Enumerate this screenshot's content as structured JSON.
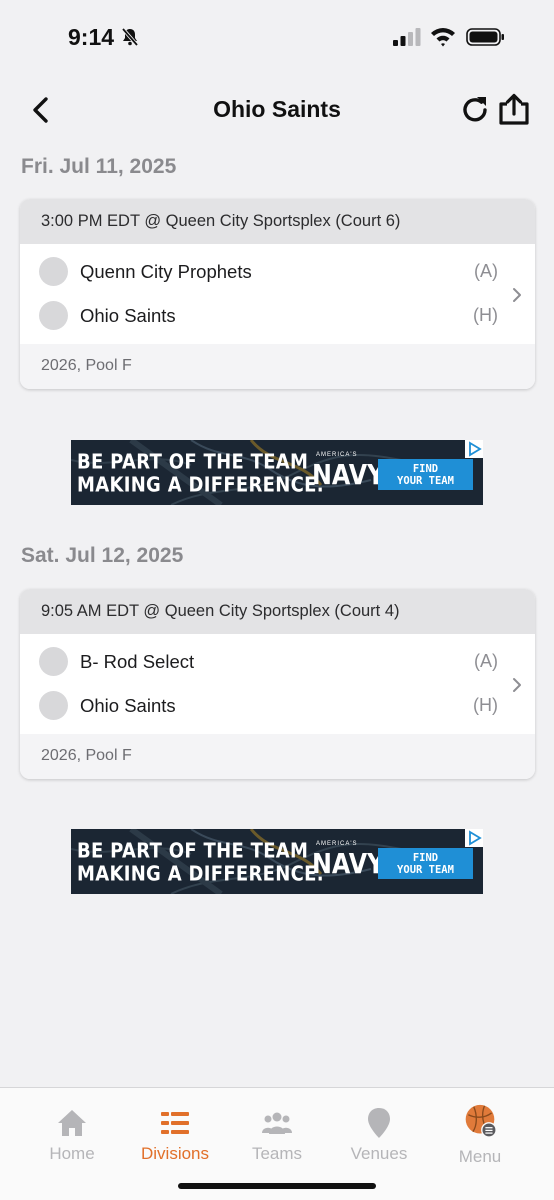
{
  "status_bar": {
    "time": "9:14"
  },
  "header": {
    "title": "Ohio Saints"
  },
  "games": [
    {
      "date": "Fri. Jul 11, 2025",
      "time_location": "3:00 PM EDT @ Queen City Sportsplex (Court 6)",
      "teams": [
        {
          "name": "Quenn City Prophets",
          "side": "(A)"
        },
        {
          "name": "Ohio Saints",
          "side": "(H)"
        }
      ],
      "division": "2026, Pool F"
    },
    {
      "date": "Sat. Jul 12, 2025",
      "time_location": "9:05 AM EDT @ Queen City Sportsplex (Court 4)",
      "teams": [
        {
          "name": "B- Rod Select",
          "side": "(A)"
        },
        {
          "name": "Ohio Saints",
          "side": "(H)"
        }
      ],
      "division": "2026, Pool F"
    }
  ],
  "ad": {
    "line1": "BE PART OF THE TEAM",
    "line2": "MAKING A DIFFERENCE.",
    "brand_small": "AMERICA'S",
    "brand": "NAVY",
    "cta_line1": "FIND",
    "cta_line2": "YOUR TEAM"
  },
  "tab_bar": {
    "tabs": [
      {
        "label": "Home",
        "icon": "home-icon"
      },
      {
        "label": "Divisions",
        "icon": "divisions-icon",
        "active": true
      },
      {
        "label": "Teams",
        "icon": "teams-icon"
      },
      {
        "label": "Venues",
        "icon": "venues-icon"
      },
      {
        "label": "Menu",
        "icon": "menu-avatar-icon"
      }
    ]
  },
  "colors": {
    "accent": "#e1702a",
    "background": "#f1f1f3",
    "card_header": "#e3e3e5",
    "inactive_tab": "#b5b5b8"
  }
}
